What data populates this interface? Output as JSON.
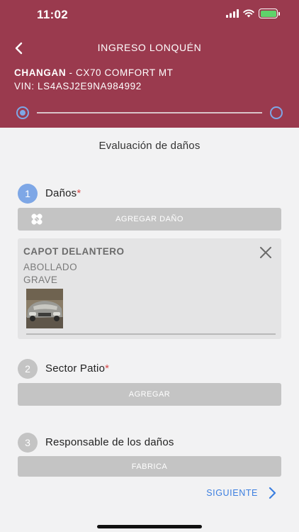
{
  "status_bar": {
    "time": "11:02"
  },
  "header": {
    "title": "INGRESO LONQUÉN",
    "vehicle_brand": "CHANGAN",
    "vehicle_model": " - CX70 COMFORT MT",
    "vin": "VIN: LS4ASJ2E9NA984992"
  },
  "main": {
    "title": "Evaluación de daños",
    "sections": [
      {
        "number": "1",
        "label": "Daños",
        "required": "*",
        "button": "AGREGAR DAÑO"
      },
      {
        "number": "2",
        "label": "Sector Patio",
        "required": "*",
        "button": "AGREGAR"
      },
      {
        "number": "3",
        "label": "Responsable de los daños",
        "button": "FABRICA"
      }
    ],
    "damage": {
      "part": "CAPOT DELANTERO",
      "type": "ABOLLADO",
      "severity": "GRAVE"
    }
  },
  "footer": {
    "next_label": "SIGUIENTE"
  },
  "colors": {
    "header_bg": "#9a3a4e",
    "accent_blue": "#7ea7e6",
    "link_blue": "#3c7fe0",
    "required_red": "#d84a4a",
    "disabled_gray": "#c4c4c4"
  },
  "icons": [
    "back-chevron-icon",
    "wifi-icon",
    "signal-icon",
    "battery-icon",
    "bandage-icon",
    "close-icon",
    "chevron-right-icon"
  ]
}
